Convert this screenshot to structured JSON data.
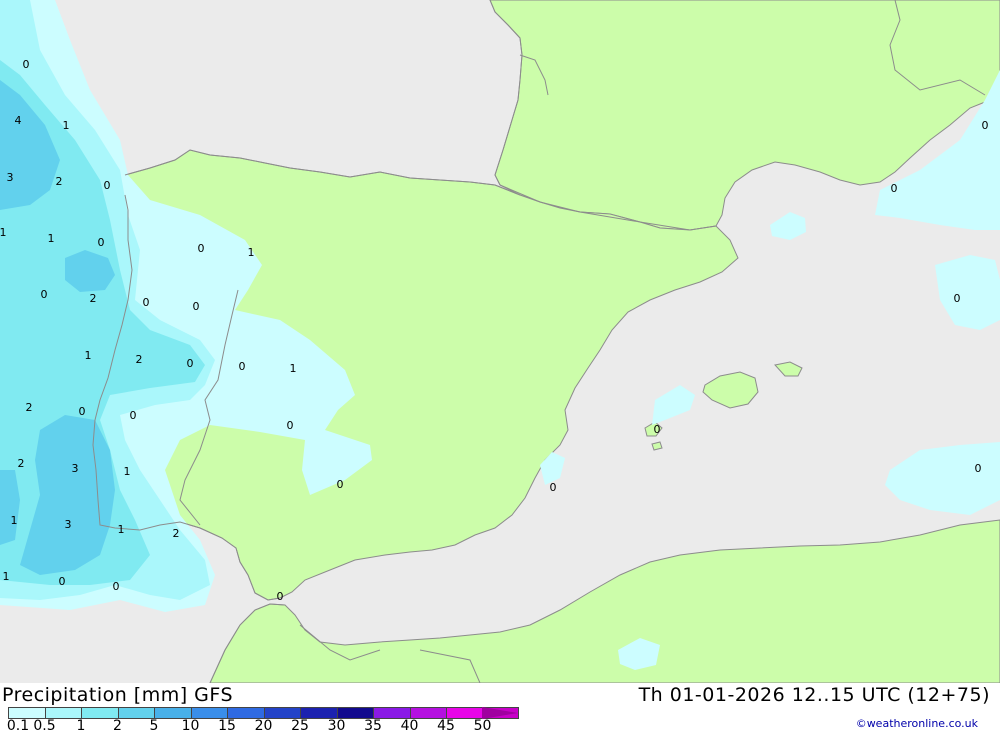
{
  "header": {
    "title": "Precipitation [mm] GFS",
    "datetime": "Th 01-01-2026 12..15 UTC (12+75)",
    "credit": "©weatheronline.co.uk"
  },
  "legend": {
    "items": [
      {
        "label": "0.1",
        "color": "#ccfdff"
      },
      {
        "label": "0.5",
        "color": "#aaf7fb"
      },
      {
        "label": "1",
        "color": "#80eaf1"
      },
      {
        "label": "2",
        "color": "#62d1ed"
      },
      {
        "label": "5",
        "color": "#48b0e9"
      },
      {
        "label": "10",
        "color": "#3a8eea"
      },
      {
        "label": "15",
        "color": "#2f6ae2"
      },
      {
        "label": "20",
        "color": "#2343c8"
      },
      {
        "label": "25",
        "color": "#1c22b0"
      },
      {
        "label": "30",
        "color": "#120a8e"
      },
      {
        "label": "35",
        "color": "#8a1ae6"
      },
      {
        "label": "40",
        "color": "#b510e0"
      },
      {
        "label": "45",
        "color": "#e805e8"
      },
      {
        "label": "50",
        "color": "#c800c8"
      }
    ]
  },
  "map": {
    "colors": {
      "sea": "#ebebeb",
      "land": "#ccfdaa",
      "border": "#8c8c8c",
      "precip_0_1": "#ccfdff",
      "precip_0_5": "#aaf7fb",
      "precip_1": "#80eaf1",
      "precip_2": "#62d1ed"
    },
    "contour_labels": [
      "0",
      "4",
      "1",
      "3",
      "2",
      "0",
      "1",
      "1",
      "0",
      "2",
      "0",
      "0",
      "0",
      "0",
      "1",
      "1",
      "2",
      "0",
      "0",
      "1",
      "2",
      "0",
      "0",
      "2",
      "3",
      "1",
      "1",
      "3",
      "1",
      "2",
      "0",
      "0",
      "1",
      "0",
      "0",
      "0",
      "0",
      "0",
      "0",
      "0",
      "0"
    ]
  }
}
